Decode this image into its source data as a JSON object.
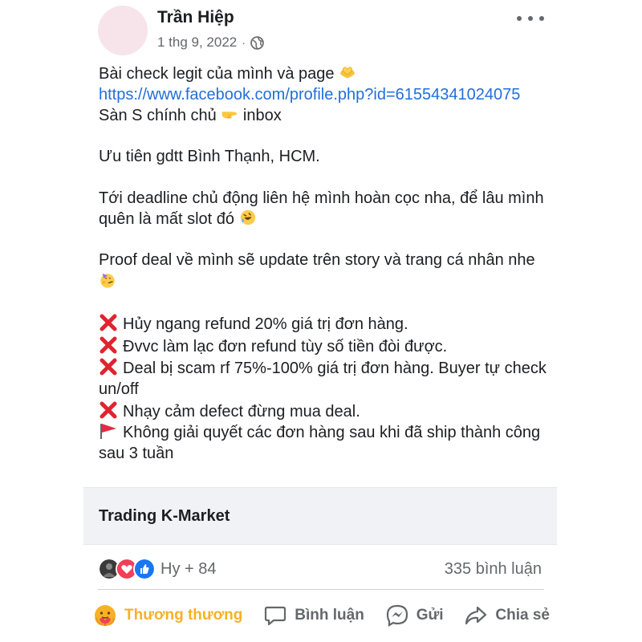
{
  "post": {
    "author": "Trần Hiệp",
    "date": "1 thg 9, 2022",
    "separator": "·",
    "privacy_icon": "globe-icon",
    "lines": {
      "l1": "Bài check legit của mình và page",
      "link": "https://www.facebook.com/profile.php?id=61554341024075",
      "l3a": "Sàn S chính chủ",
      "l3b": "inbox",
      "l4": "Ưu tiên gdtt Bình Thạnh, HCM.",
      "l5": "Tới deadline chủ động liên hệ mình hoàn cọc nha, để lâu mình quên là mất slot đó",
      "l6": "Proof deal về mình sẽ update trên story và trang cá nhân nhe",
      "r1": "Hủy ngang refund 20% giá trị đơn hàng.",
      "r2": "Đvvc làm lạc đơn refund tùy số tiền đòi được.",
      "r3": "Deal bị scam rf 75%-100% giá trị đơn hàng. Buyer tự check un/off",
      "r4": "Nhạy cảm defect đừng mua deal.",
      "r5": "Không giải quyết các đơn hàng sau khi đã ship thành công sau 3 tuần"
    },
    "emojis": [
      "heart-hands-emoji",
      "pointing-right-emoji",
      "rofl-emoji",
      "partying-face-emoji",
      "cross-mark-emoji",
      "red-flag-emoji"
    ]
  },
  "group": {
    "name": "Trading K-Market"
  },
  "reactions": {
    "icons": [
      "avatar-reaction",
      "love-reaction",
      "like-reaction"
    ],
    "summary": "Hy + 84",
    "comments": "335 bình luận"
  },
  "actions": {
    "react_label": "Thương thương",
    "comment_label": "Bình luận",
    "send_label": "Gửi",
    "share_label": "Chia sẻ"
  },
  "colors": {
    "link": "#216fdb",
    "care_active": "#f7b125",
    "muted": "#65676b",
    "like_blue": "#1877f2",
    "love_red": "#f33e58",
    "cross_red": "#e0242f"
  }
}
